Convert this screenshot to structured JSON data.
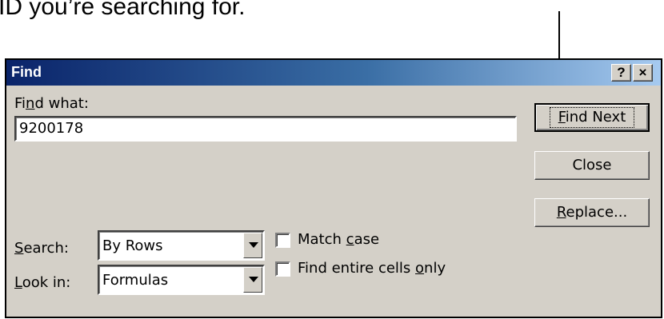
{
  "caption": "ID you’re searching for.",
  "dialog": {
    "title": "Find",
    "help_button": "?",
    "close_button": "×",
    "find_what": {
      "label_pre": "Fi",
      "label_u": "n",
      "label_post": "d what:",
      "value": "9200178"
    },
    "buttons": {
      "find_next": {
        "u": "F",
        "rest": "ind Next"
      },
      "close": "Close",
      "replace": {
        "u": "R",
        "rest": "eplace..."
      }
    },
    "search": {
      "label_u": "S",
      "label_rest": "earch:",
      "value": "By Rows"
    },
    "look_in": {
      "label_u": "L",
      "label_rest": "ook in:",
      "value": "Formulas"
    },
    "match_case": {
      "pre": "Match ",
      "u": "c",
      "post": "ase",
      "checked": false
    },
    "entire_cells": {
      "pre": "Find entire cells ",
      "u": "o",
      "post": "nly",
      "checked": false
    }
  }
}
